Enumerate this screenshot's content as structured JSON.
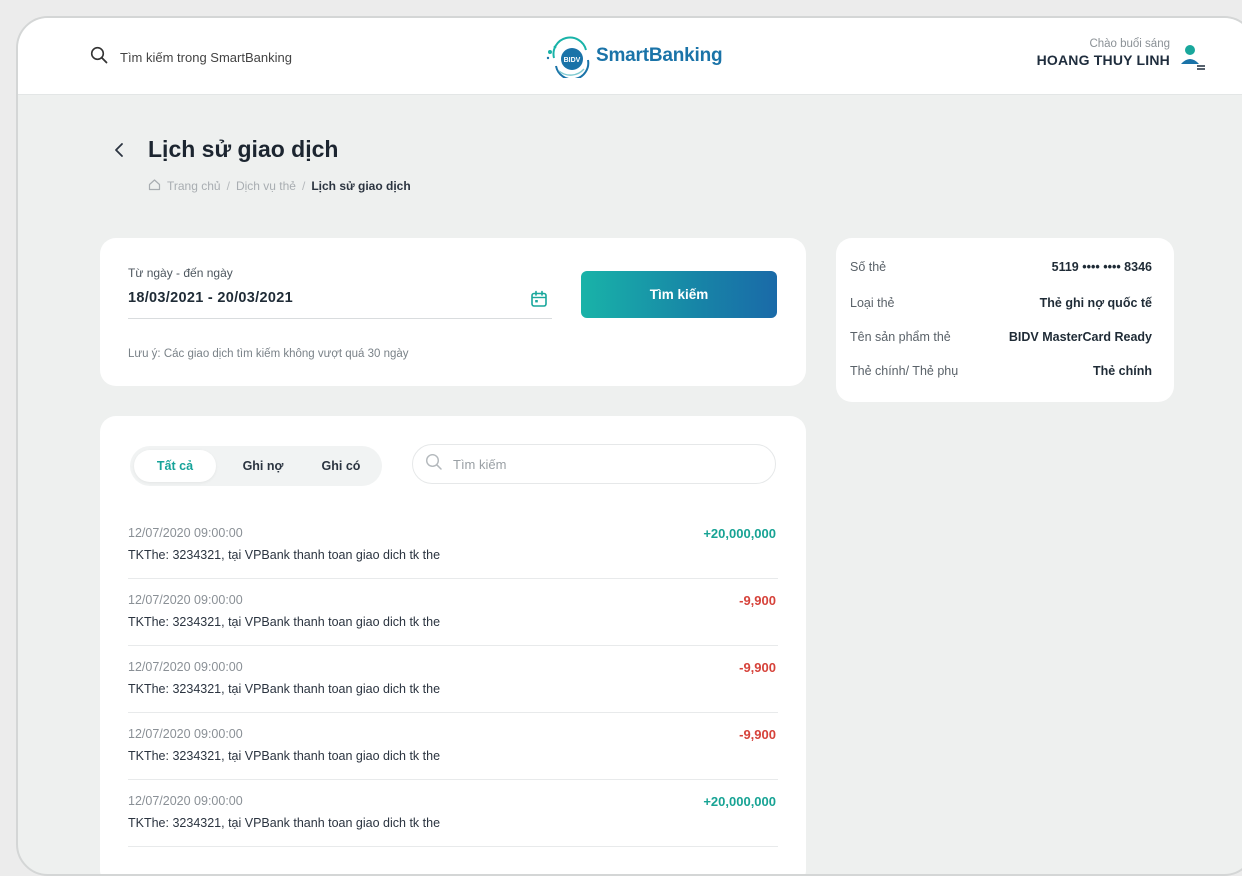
{
  "header": {
    "search_placeholder": "Tìm kiếm trong SmartBanking",
    "brand_badge": "BIDV",
    "brand_name": "SmartBanking",
    "greeting": "Chào buổi sáng",
    "user_name": "HOANG THUY LINH"
  },
  "page": {
    "title": "Lịch sử giao dịch",
    "breadcrumb": [
      "Trang chủ",
      "Dịch vụ thẻ",
      "Lịch sử giao dịch"
    ]
  },
  "filter": {
    "date_label": "Từ ngày - đến ngày",
    "date_value": "18/03/2021 - 20/03/2021",
    "search_button": "Tìm kiếm",
    "note": "Lưu ý: Các giao dịch tìm kiếm không vượt quá 30 ngày"
  },
  "card_info": {
    "rows": [
      {
        "label": "Số thẻ",
        "value": "5119 •••• •••• 8346"
      },
      {
        "label": "Loại thẻ",
        "value": "Thẻ ghi nợ quốc tế"
      },
      {
        "label": "Tên sản phẩm thẻ",
        "value": "BIDV MasterCard Ready"
      },
      {
        "label": "Thẻ chính/ Thẻ phụ",
        "value": "Thẻ chính"
      }
    ]
  },
  "transactions": {
    "tabs": [
      "Tất cả",
      "Ghi nợ",
      "Ghi có"
    ],
    "active_tab": "Tất cả",
    "search_placeholder": "Tìm kiếm",
    "items": [
      {
        "datetime": "12/07/2020  09:00:00",
        "description": "TKThe: 3234321, tại VPBank thanh toan giao dich tk the",
        "amount": "+20,000,000",
        "type": "credit"
      },
      {
        "datetime": "12/07/2020  09:00:00",
        "description": "TKThe: 3234321, tại VPBank thanh toan giao dich tk the",
        "amount": "-9,900",
        "type": "debit"
      },
      {
        "datetime": "12/07/2020  09:00:00",
        "description": "TKThe: 3234321, tại VPBank thanh toan giao dich tk the",
        "amount": "-9,900",
        "type": "debit"
      },
      {
        "datetime": "12/07/2020  09:00:00",
        "description": "TKThe: 3234321, tại VPBank thanh toan giao dich tk the",
        "amount": "-9,900",
        "type": "debit"
      },
      {
        "datetime": "12/07/2020  09:00:00",
        "description": "TKThe: 3234321, tại VPBank thanh toan giao dich tk the",
        "amount": "+20,000,000",
        "type": "credit"
      }
    ]
  },
  "colors": {
    "accent": "#16a39a",
    "credit": "#17a394",
    "debit": "#d6423a",
    "button_gradient": [
      "#19b3a8",
      "#1a6aa8"
    ]
  },
  "icons": [
    "search-icon",
    "bidv-logo-icon",
    "user-avatar-icon",
    "back-arrow-icon",
    "home-icon",
    "calendar-icon"
  ]
}
